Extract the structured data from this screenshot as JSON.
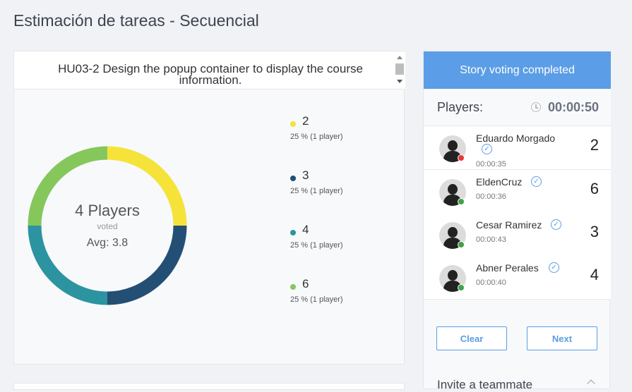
{
  "page": {
    "title": "Estimación de tareas - Secuencial"
  },
  "story": {
    "title": "HU03-2 Design the popup container to display the course information."
  },
  "summary": {
    "players_text": "4 Players",
    "voted_text": "voted",
    "avg_text": "Avg: 3.8"
  },
  "legend": [
    {
      "value": "2",
      "detail": "25 % (1 player)",
      "color": "#f5e33a"
    },
    {
      "value": "3",
      "detail": "25 % (1 player)",
      "color": "#244f75"
    },
    {
      "value": "4",
      "detail": "25 % (1 player)",
      "color": "#2b94a0"
    },
    {
      "value": "6",
      "detail": "25 % (1 player)",
      "color": "#86c75c"
    }
  ],
  "chart_data": {
    "type": "pie",
    "categories": [
      "2",
      "3",
      "4",
      "6"
    ],
    "values": [
      25,
      25,
      25,
      25
    ],
    "colors": [
      "#f5e33a",
      "#244f75",
      "#2b94a0",
      "#86c75c"
    ]
  },
  "panel": {
    "banner": "Story voting completed",
    "players_label": "Players:",
    "timer": "00:00:50",
    "clear_label": "Clear",
    "next_label": "Next",
    "invite_label": "Invite a teammate"
  },
  "players": [
    {
      "name": "Eduardo Morgado",
      "time": "00:00:35",
      "vote": "2",
      "status_color": "#e53935"
    },
    {
      "name": "EldenCruz",
      "time": "00:00:36",
      "vote": "6",
      "status_color": "#43a047"
    },
    {
      "name": "Cesar Ramirez",
      "time": "00:00:43",
      "vote": "3",
      "status_color": "#43a047"
    },
    {
      "name": "Abner Perales",
      "time": "00:00:40",
      "vote": "4",
      "status_color": "#43a047"
    }
  ]
}
